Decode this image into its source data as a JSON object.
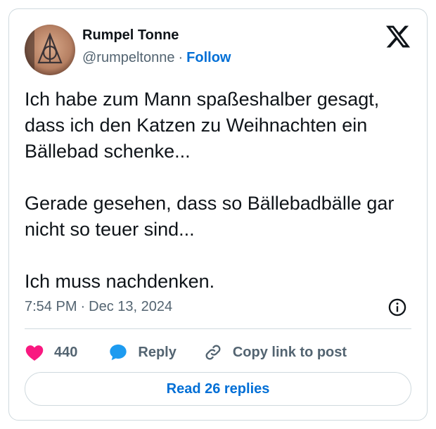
{
  "author": {
    "name": "Rumpel Tonne",
    "handle": "@rumpeltonne",
    "separator": "·",
    "follow_label": "Follow",
    "avatar_icon": "avatar-image"
  },
  "header": {
    "logo_icon": "x-logo-icon"
  },
  "tweet": {
    "paragraphs": [
      "Ich habe zum Mann spaßeshalber gesagt, dass ich den Katzen zu Weihnachten ein Bällebad schenke...",
      "Gerade gesehen, dass so Bällebadbälle gar nicht so teuer sind...",
      "Ich muss nachdenken."
    ],
    "time": "7:54 PM",
    "separator": "·",
    "date": "Dec 13, 2024"
  },
  "actions": {
    "like_count": "440",
    "reply_label": "Reply",
    "copy_label": "Copy link to post"
  },
  "footer": {
    "read_replies_label": "Read 26 replies"
  },
  "colors": {
    "accent": "#006fd6",
    "like": "#f91880",
    "reply_icon": "#1d9bf0",
    "muted": "#536471",
    "border": "#cfd9de"
  }
}
